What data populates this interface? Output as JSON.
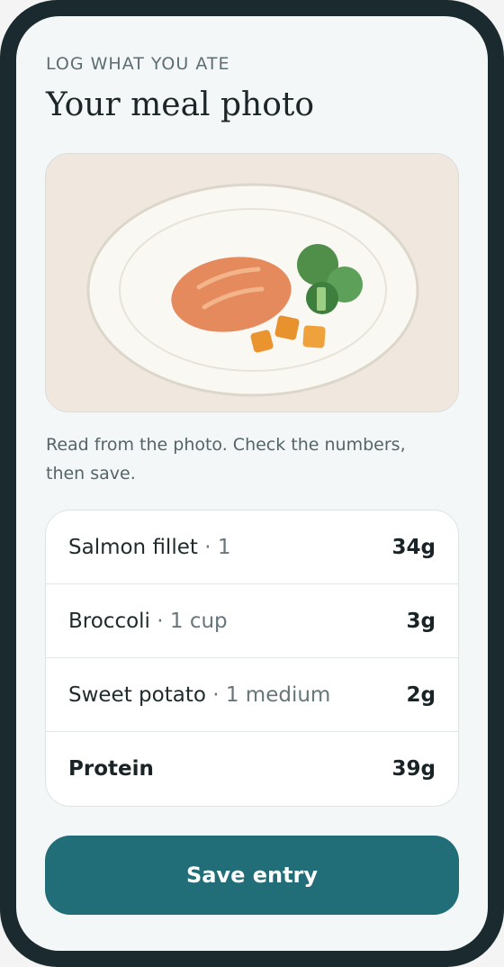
{
  "header": {
    "kicker": "LOG WHAT YOU ATE",
    "title": "Your meal photo"
  },
  "photo": {
    "icon": "meal-plate-illustration",
    "colors": {
      "background": "#f0e8df",
      "plate": "#faf8f3",
      "salmon": "#e58a5c",
      "broccoli": "#4f8f4a",
      "sweet_potato": "#e8922e"
    }
  },
  "caption": "Read from the photo. Check the numbers, then save.",
  "items": [
    {
      "name": "Salmon fillet",
      "separator": "·",
      "quantity": "1",
      "amount": "34g"
    },
    {
      "name": "Broccoli",
      "separator": "·",
      "quantity": "1 cup",
      "amount": "3g"
    },
    {
      "name": "Sweet potato",
      "separator": "·",
      "quantity": "1 medium",
      "amount": "2g"
    }
  ],
  "total": {
    "label": "Protein",
    "amount": "39g"
  },
  "actions": {
    "save_label": "Save entry"
  },
  "colors": {
    "accent": "#216e78",
    "frame": "#1a2a2e",
    "screen": "#f4f7f8"
  }
}
